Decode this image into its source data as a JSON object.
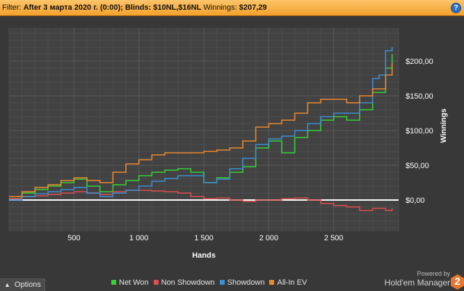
{
  "header": {
    "filter_label": "Filter:",
    "filter_value": "After 3 марта 2020 г. (0:00); Blinds: $10NL,$16NL",
    "winnings_label": "Winnings:",
    "winnings_value": "$207,29",
    "help_icon": "question-icon"
  },
  "options_button": {
    "label": "Options",
    "icon": "chevron-up-icon"
  },
  "branding": {
    "powered_by": "Powered by",
    "name": "Hold'em Manager",
    "logo_text": "2"
  },
  "chart_data": {
    "type": "line",
    "xlabel": "Hands",
    "ylabel": "Winnings",
    "xlim": [
      0,
      3000
    ],
    "ylim": [
      -45,
      248
    ],
    "x_ticks": [
      500,
      1000,
      1500,
      2000,
      2500
    ],
    "x_tick_labels": [
      "500",
      "1 000",
      "1 500",
      "2 000",
      "2 500"
    ],
    "y_ticks": [
      0,
      50,
      100,
      150,
      200
    ],
    "y_tick_labels": [
      "$0,00",
      "$50,00",
      "$100,00",
      "$150,00",
      "$200,00"
    ],
    "grid": true,
    "legend_position": "bottom",
    "series": [
      {
        "name": "Net Won",
        "color": "#35d435",
        "x": [
          0,
          100,
          200,
          300,
          400,
          500,
          600,
          700,
          800,
          900,
          1000,
          1100,
          1200,
          1300,
          1400,
          1500,
          1600,
          1700,
          1800,
          1900,
          2000,
          2080,
          2100,
          2200,
          2300,
          2400,
          2500,
          2600,
          2700,
          2800,
          2900,
          2950
        ],
        "values": [
          2,
          10,
          15,
          20,
          25,
          30,
          20,
          12,
          22,
          28,
          35,
          40,
          43,
          45,
          40,
          25,
          32,
          40,
          48,
          75,
          85,
          85,
          68,
          90,
          100,
          115,
          120,
          115,
          130,
          155,
          190,
          210
        ]
      },
      {
        "name": "Non Showdown",
        "color": "#e04e4e",
        "x": [
          0,
          100,
          200,
          300,
          400,
          500,
          600,
          700,
          800,
          900,
          1000,
          1100,
          1200,
          1300,
          1400,
          1500,
          1600,
          1700,
          1800,
          1900,
          2000,
          2100,
          2200,
          2300,
          2400,
          2500,
          2600,
          2700,
          2800,
          2900,
          2950
        ],
        "values": [
          2,
          5,
          6,
          8,
          10,
          12,
          10,
          8,
          12,
          14,
          14,
          13,
          12,
          10,
          5,
          2,
          3,
          0,
          -2,
          0,
          0,
          2,
          3,
          0,
          -5,
          -8,
          -10,
          -15,
          -12,
          -15,
          -12
        ]
      },
      {
        "name": "Showdown",
        "color": "#3d8fd6",
        "x": [
          0,
          100,
          200,
          300,
          400,
          500,
          600,
          700,
          800,
          900,
          1000,
          1100,
          1200,
          1300,
          1400,
          1500,
          1600,
          1700,
          1800,
          1900,
          2000,
          2100,
          2200,
          2300,
          2400,
          2500,
          2600,
          2700,
          2800,
          2850,
          2900,
          2950
        ],
        "values": [
          0,
          5,
          9,
          12,
          15,
          18,
          10,
          5,
          10,
          14,
          20,
          27,
          31,
          35,
          35,
          25,
          30,
          45,
          60,
          80,
          88,
          92,
          100,
          110,
          120,
          125,
          125,
          140,
          175,
          180,
          215,
          220
        ]
      },
      {
        "name": "All-In EV",
        "color": "#ef8a2c",
        "x": [
          0,
          100,
          200,
          300,
          400,
          500,
          600,
          700,
          800,
          900,
          1000,
          1100,
          1200,
          1300,
          1400,
          1500,
          1600,
          1700,
          1800,
          1900,
          2000,
          2100,
          2200,
          2300,
          2400,
          2500,
          2600,
          2700,
          2800,
          2900,
          2950
        ],
        "values": [
          5,
          12,
          18,
          22,
          28,
          32,
          28,
          25,
          40,
          52,
          58,
          65,
          68,
          68,
          68,
          70,
          72,
          75,
          85,
          105,
          110,
          115,
          125,
          140,
          145,
          145,
          140,
          150,
          160,
          180,
          197
        ]
      }
    ]
  }
}
